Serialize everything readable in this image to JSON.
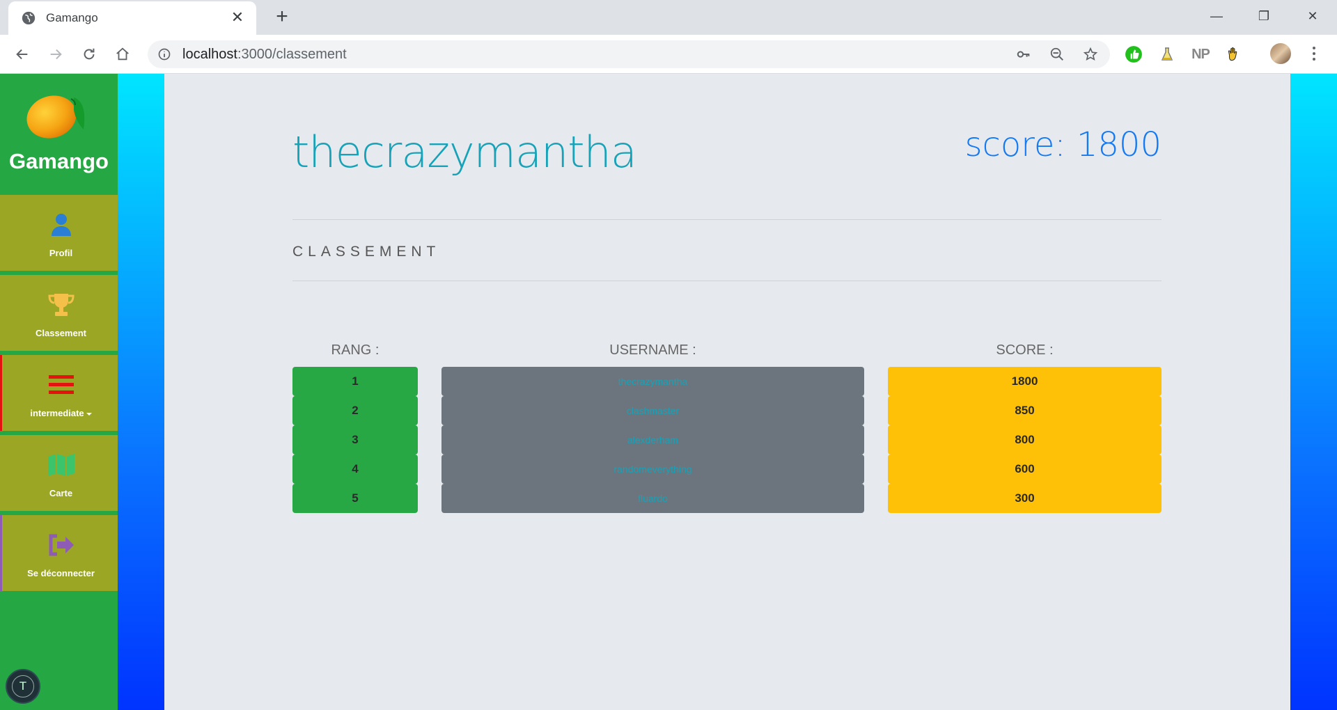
{
  "browser": {
    "tab_title": "Gamango",
    "url_host": "localhost",
    "url_path": ":3000/classement",
    "new_tab_symbol": "+",
    "extension_np": "NP"
  },
  "sidebar": {
    "brand": "Gamango",
    "items": [
      {
        "label": "Profil",
        "icon": "user-icon",
        "icon_color": "#2a7fd4"
      },
      {
        "label": "Classement",
        "icon": "trophy-icon",
        "icon_color": "#f5c04a"
      },
      {
        "label": "intermediate",
        "icon": "bars-icon",
        "icon_color": "#e3130f",
        "dropdown": true
      },
      {
        "label": "Carte",
        "icon": "map-icon",
        "icon_color": "#3cc46b"
      },
      {
        "label": "Se déconnecter",
        "icon": "sign-out-icon",
        "icon_color": "#8e5bb5"
      }
    ],
    "chip_letter": "T"
  },
  "main": {
    "username": "thecrazymantha",
    "score_text": "score: 1800",
    "section_title": "CLASSEMENT",
    "columns": {
      "rank": "RANG :",
      "username": "USERNAME :",
      "score": "SCORE :"
    },
    "rows": [
      {
        "rank": "1",
        "username": "thecrazymantha",
        "score": "1800"
      },
      {
        "rank": "2",
        "username": "clashmaster",
        "score": "850"
      },
      {
        "rank": "3",
        "username": "alexderham",
        "score": "800"
      },
      {
        "rank": "4",
        "username": "randomeverything",
        "score": "600"
      },
      {
        "rank": "5",
        "username": "fluardo",
        "score": "300"
      }
    ]
  },
  "colors": {
    "sidebar_bg": "#25a844",
    "nav_item_bg": "#9aa624",
    "rank_cell": "#28a745",
    "username_cell": "#6c757d",
    "score_cell": "#ffc107",
    "title_accent": "#17a2b8",
    "score_accent": "#1479f2"
  }
}
